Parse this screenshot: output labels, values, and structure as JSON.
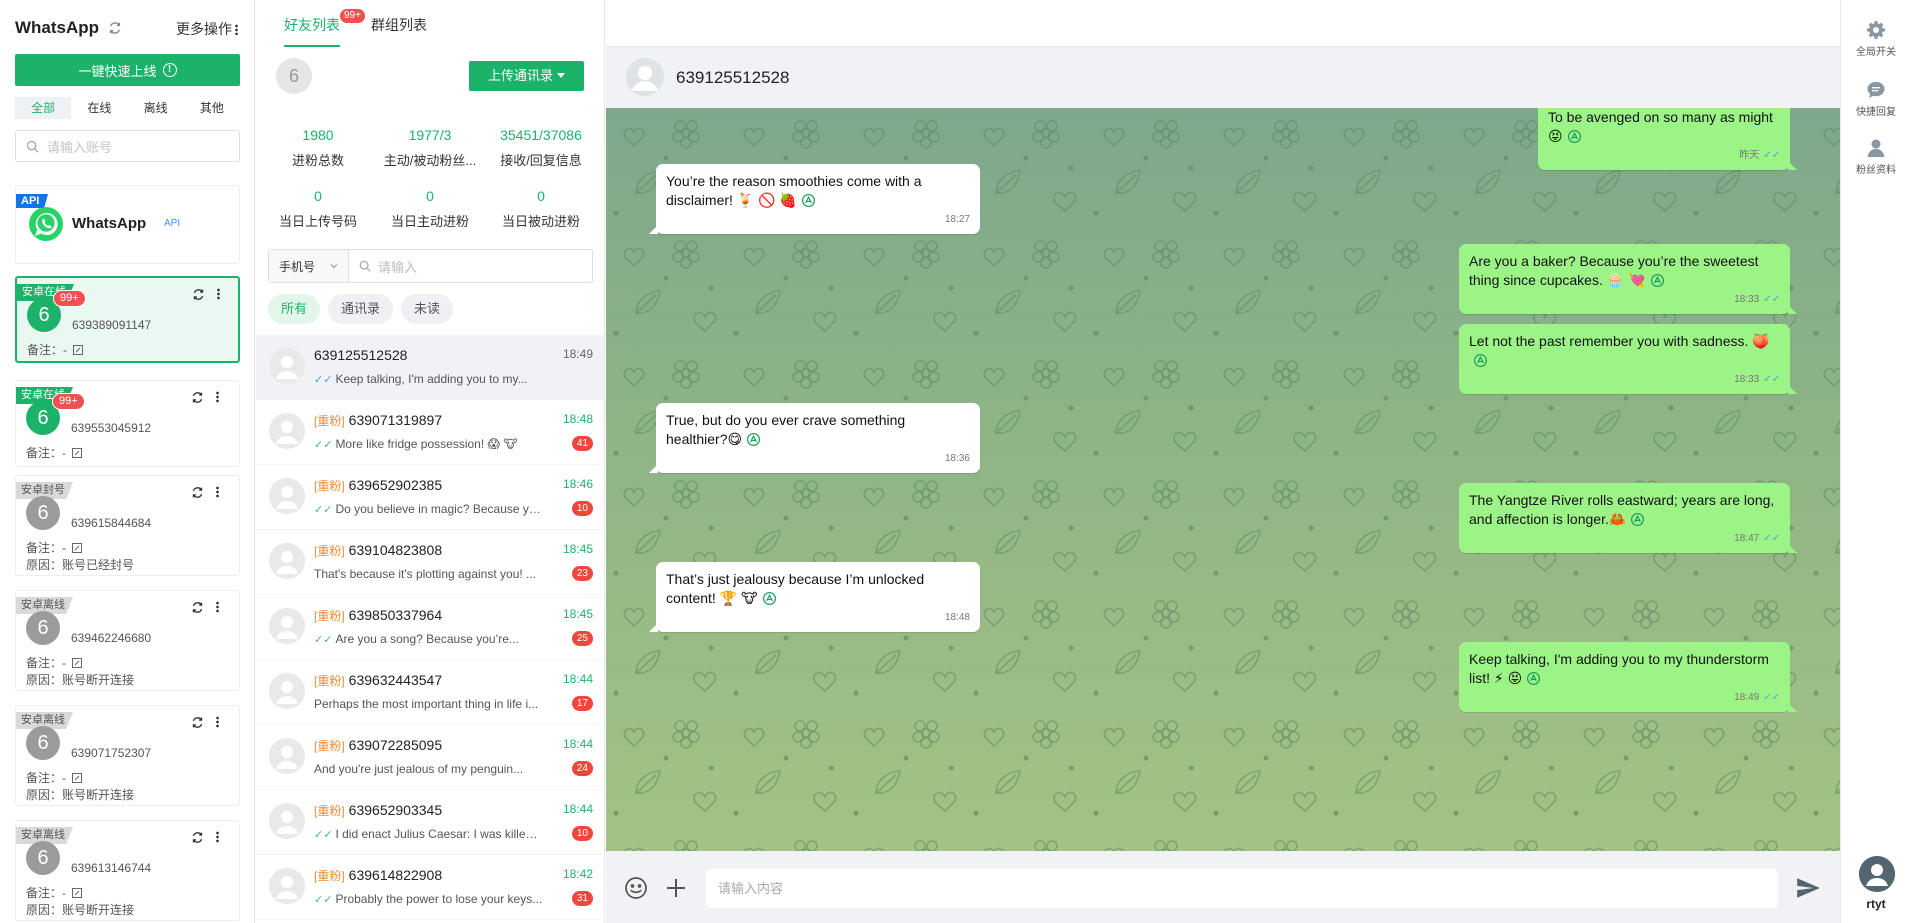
{
  "app": {
    "title": "WhatsApp",
    "more_label": "更多操作"
  },
  "left": {
    "quick_online_label": "一键快速上线",
    "filters": [
      "全部",
      "在线",
      "离线",
      "其他"
    ],
    "search_placeholder": "请输入账号",
    "api_card": {
      "tag": "API",
      "name": "WhatsApp",
      "sub": "API"
    },
    "accounts": [
      {
        "ribbon": "安卓在线",
        "avatar": "6",
        "badge": "99+",
        "phone": "639389091147",
        "note": "备注：-",
        "reason": ""
      },
      {
        "ribbon": "安卓在线",
        "avatar": "6",
        "badge": "99+",
        "phone": "639553045912",
        "note": "备注：-",
        "reason": ""
      },
      {
        "ribbon": "安卓封号",
        "avatar": "6",
        "badge": "",
        "phone": "639615844684",
        "note": "备注：-",
        "reason": "原因：账号已经封号"
      },
      {
        "ribbon": "安卓离线",
        "avatar": "6",
        "badge": "",
        "phone": "639462246680",
        "note": "备注：-",
        "reason": "原因：账号断开连接"
      },
      {
        "ribbon": "安卓离线",
        "avatar": "6",
        "badge": "",
        "phone": "639071752307",
        "note": "备注：-",
        "reason": "原因：账号断开连接"
      },
      {
        "ribbon": "安卓离线",
        "avatar": "6",
        "badge": "",
        "phone": "639613146744",
        "note": "备注：-",
        "reason": "原因：账号断开连接"
      }
    ]
  },
  "contacts": {
    "tabs": {
      "friends": "好友列表",
      "friends_badge": "99+",
      "groups": "群组列表"
    },
    "avatar_num": "6",
    "upload_label": "上传通讯录",
    "stats": [
      {
        "value": "1980",
        "label": "进粉总数"
      },
      {
        "value": "1977/3",
        "label": "主动/被动粉丝..."
      },
      {
        "value": "35451/37086",
        "label": "接收/回复信息"
      },
      {
        "value": "0",
        "label": "当日上传号码"
      },
      {
        "value": "0",
        "label": "当日主动进粉"
      },
      {
        "value": "0",
        "label": "当日被动进粉"
      }
    ],
    "search": {
      "select": "手机号",
      "placeholder": "请输入"
    },
    "chips": [
      "所有",
      "通讯录",
      "未读"
    ],
    "list": [
      {
        "tag": "",
        "phone": "639125512528",
        "time": "18:49",
        "msg": "Keep talking, I'm adding you to my...",
        "tick": true,
        "count": ""
      },
      {
        "tag": "[重粉]",
        "phone": "639071319897",
        "time": "18:48",
        "msg": "More like fridge possession! 😱 🐮",
        "tick": true,
        "count": "41"
      },
      {
        "tag": "[重粉]",
        "phone": "639652902385",
        "time": "18:46",
        "msg": "Do you believe in magic? Because yo...",
        "tick": true,
        "count": "10"
      },
      {
        "tag": "[重粉]",
        "phone": "639104823808",
        "time": "18:45",
        "msg": "That's because it's plotting against you! ...",
        "tick": false,
        "count": "23"
      },
      {
        "tag": "[重粉]",
        "phone": "639850337964",
        "time": "18:45",
        "msg": "Are you a song? Because you’re...",
        "tick": true,
        "count": "25"
      },
      {
        "tag": "[重粉]",
        "phone": "639632443547",
        "time": "18:44",
        "msg": "Perhaps the most important thing in life i...",
        "tick": false,
        "count": "17"
      },
      {
        "tag": "[重粉]",
        "phone": "639072285095",
        "time": "18:44",
        "msg": "And you're just jealous of my penguin...",
        "tick": false,
        "count": "24"
      },
      {
        "tag": "[重粉]",
        "phone": "639652903345",
        "time": "18:44",
        "msg": "I did enact Julius Caesar: I was killed i'...",
        "tick": true,
        "count": "10"
      },
      {
        "tag": "[重粉]",
        "phone": "639614822908",
        "time": "18:42",
        "msg": "Probably the power to lose your keys...",
        "tick": true,
        "count": "31"
      }
    ]
  },
  "chat": {
    "name": "639125512528",
    "messages": [
      {
        "dir": "out",
        "text": "To be avenged on so many as might😝",
        "time": "昨天"
      },
      {
        "dir": "in",
        "text": "You’re the reason smoothies come with a disclaimer! 🍹 🚫 🍓",
        "time": "18:27"
      },
      {
        "dir": "out",
        "text": "Are you a baker? Because you’re the sweetest thing since cupcakes. 🧁 💘",
        "time": "18:33"
      },
      {
        "dir": "out",
        "text": "Let not the past remember you with sadness. 🍑",
        "time": "18:33"
      },
      {
        "dir": "in",
        "text": "True, but do you ever crave something healthier?😋",
        "time": "18:36"
      },
      {
        "dir": "out",
        "text": "The Yangtze River rolls eastward; years are long, and affection is longer.🦀",
        "time": "18:47"
      },
      {
        "dir": "in",
        "text": "That’s just jealousy because I’m unlocked content! 🏆 🐮",
        "time": "18:48"
      },
      {
        "dir": "out",
        "text": "Keep talking, I'm adding you to my thunderstorm list! ⚡ 😝",
        "time": "18:49"
      }
    ],
    "composer_placeholder": "请输入内容"
  },
  "rail": {
    "items": [
      {
        "label": "全局开关",
        "icon": "gear-icon"
      },
      {
        "label": "快捷回复",
        "icon": "chat-icon"
      },
      {
        "label": "粉丝资料",
        "icon": "user-icon"
      }
    ],
    "user": "rtyt"
  },
  "colors": {
    "accent": "#1db26a",
    "badge": "#f05050",
    "bubble_out": "#9cf487",
    "tag_orange": "#f08c3a"
  }
}
